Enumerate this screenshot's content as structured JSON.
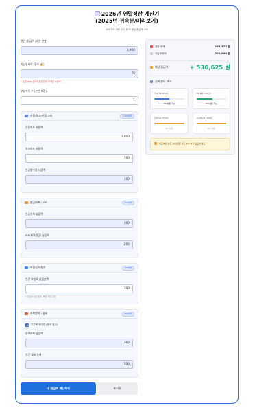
{
  "header": {
    "title_line1": "2026년 연말정산 계산기",
    "title_line2": "(2025년 귀속분/미리보기)",
    "subtitle": "소비 카드 비용 주기 위 작 예상 환급액 소비"
  },
  "form": {
    "salary": {
      "label": "연간 총 급여 (세전 연봉)",
      "value": "3,900"
    },
    "withheld": {
      "label": "기납부세액 (월수 💰)",
      "value": "70",
      "note": "* 원금계에서 소득세 원천 합계 (아래로 0 입력)"
    },
    "dependents": {
      "label": "부양가족 수 (본인 포함)",
      "value": "1"
    }
  },
  "sections": {
    "card": {
      "title": "신용/체크/현금 소비",
      "badge": "1,500만원",
      "fields": [
        {
          "label": "신용카드 사용액",
          "value": "1,000"
        },
        {
          "label": "체크카드 사용액",
          "value": "700"
        },
        {
          "label": "현금영수증 사용액",
          "value": "100"
        }
      ]
    },
    "pension": {
      "title": "연금저축 / IRP",
      "badge": "900만원",
      "fields": [
        {
          "label": "연금저축 납입액",
          "value": "300"
        },
        {
          "label": "IRP(퇴직연금) 납입액",
          "value": "200"
        }
      ]
    },
    "insurance": {
      "title": "보장성 보험료",
      "badge": "100만원",
      "fields": [
        {
          "label": "연간 보험료 납입총액",
          "value": "300"
        }
      ],
      "note": "* 자동차 보험 제외, 부양 가족 포함"
    },
    "housing": {
      "title": "주택청약 / 월세",
      "badge": "300만원",
      "checkbox": "무주택 세대주 (체크 필수)",
      "fields": [
        {
          "label": "청약저축 납입액",
          "value": "300"
        },
        {
          "label": "연간 월세 총액",
          "value": "330"
        }
      ]
    }
  },
  "buttons": {
    "calculate": "내 환급액 계산하기",
    "reset": "초기화"
  },
  "summary": {
    "determined_tax_label": "결정 세액",
    "determined_tax_value": "163,375 원",
    "prepaid_label": "기납부세액",
    "prepaid_value": "700,000 원",
    "refund_label": "예상 환급액",
    "refund_value": "+ 536,625 원"
  },
  "limits": {
    "title": "공제 한도 체크",
    "tiles": [
      {
        "title": "부녀저축 (600만)",
        "value": "300만원 가능",
        "fill": 0.5,
        "color": "#3c78e0"
      },
      {
        "title": "IRP 등외 (900만)",
        "value": "400만원 가능",
        "fill": 0.55,
        "color": "#1ea97c"
      },
      {
        "title": "청약저축 (300만)",
        "value": "0% 달성",
        "fill": 1.0,
        "color": "#e5a22a"
      },
      {
        "title": "보장성보험 (100만)",
        "value": "0% 달성",
        "fill": 1.0,
        "color": "#e5a22a"
      }
    ],
    "tip": "연금계좌 한도 600만원 한도 IRP 추가 납입하세요"
  }
}
